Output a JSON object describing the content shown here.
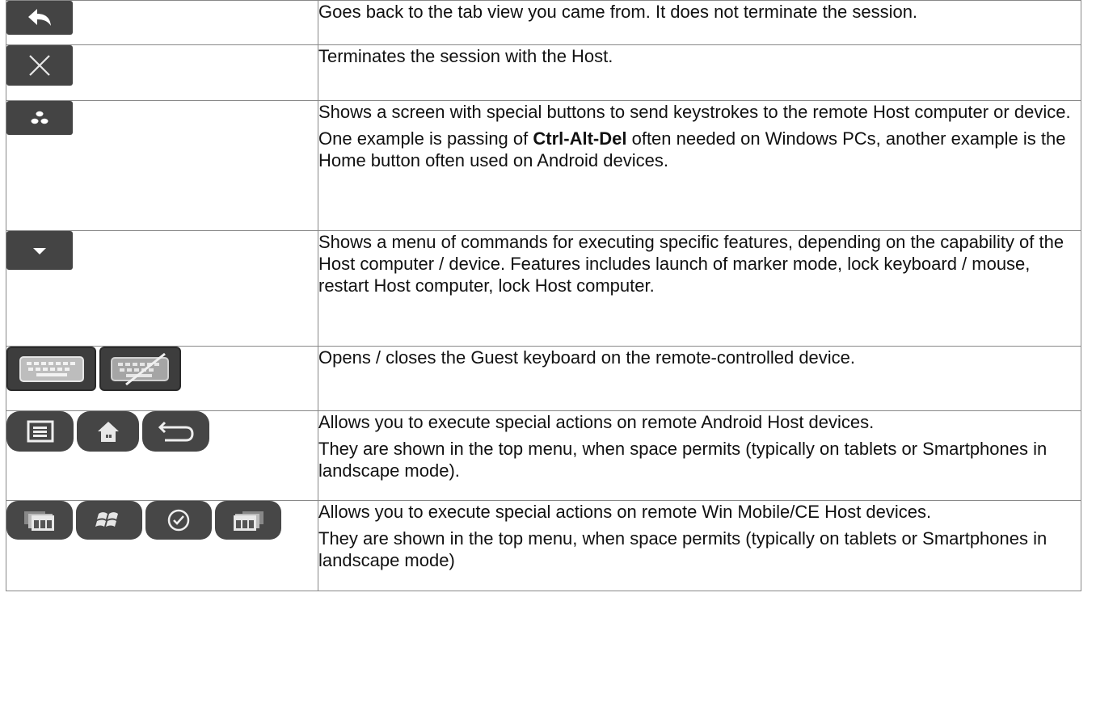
{
  "rows": [
    {
      "icons": [
        "back-arrow-icon"
      ],
      "paragraphs": [
        {
          "text": "Goes back to the tab view you came from. It does not terminate the session."
        }
      ]
    },
    {
      "icons": [
        "close-icon"
      ],
      "paragraphs": [
        {
          "text": "Terminates the session with the Host."
        }
      ]
    },
    {
      "icons": [
        "special-keys-icon"
      ],
      "paragraphs": [
        {
          "text": "Shows a screen with special buttons to send keystrokes to the remote Host computer or device."
        },
        {
          "pre": "One example is passing of ",
          "bold": "Ctrl-Alt-Del",
          "post": " often needed on Windows PCs, another example is the Home button often used on Android devices."
        }
      ]
    },
    {
      "icons": [
        "dropdown-menu-icon"
      ],
      "paragraphs": [
        {
          "text": "Shows a menu of commands for executing specific features, depending on the capability of the Host computer / device. Features includes launch of marker mode, lock keyboard / mouse, restart Host computer, lock Host computer."
        }
      ]
    },
    {
      "icons": [
        "keyboard-open-icon",
        "keyboard-close-icon"
      ],
      "paragraphs": [
        {
          "text": "Opens / closes the Guest keyboard on the remote-controlled device."
        }
      ]
    },
    {
      "icons": [
        "android-menu-icon",
        "android-home-icon",
        "android-back-icon"
      ],
      "paragraphs": [
        {
          "text": "Allows you to execute special actions on remote Android Host devices."
        },
        {
          "text": "They are shown in the top menu, when space permits (typically on tablets or Smartphones in landscape mode)."
        }
      ]
    },
    {
      "icons": [
        "winmobile-left-softkey-icon",
        "windows-start-icon",
        "ok-check-icon",
        "winmobile-right-softkey-icon"
      ],
      "paragraphs": [
        {
          "text": "Allows you to execute special actions on remote Win Mobile/CE Host devices."
        },
        {
          "text": "They are shown in the top menu, when space permits (typically on tablets or Smartphones in landscape mode)"
        }
      ]
    }
  ]
}
